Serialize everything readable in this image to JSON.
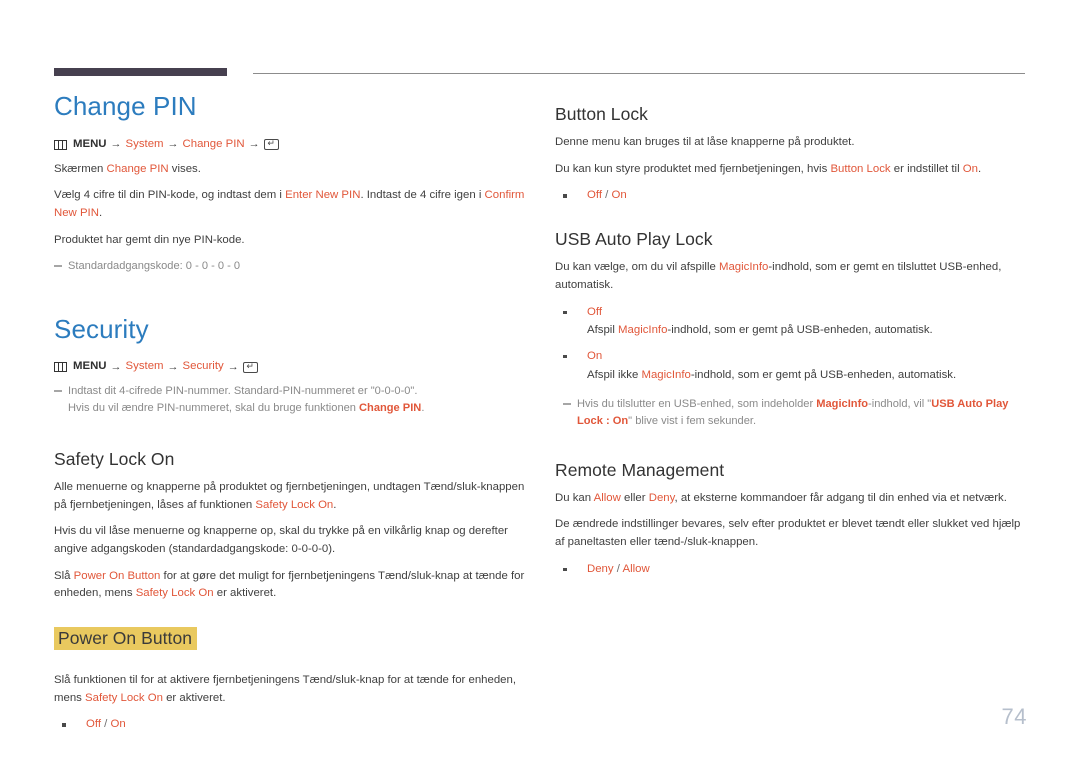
{
  "page": {
    "number": "74",
    "accent_color": "#e1573a",
    "heading_color": "#2c7cbe",
    "highlight_color": "#e9c95f",
    "rule_color": "#46404f"
  },
  "left_column": {
    "change_pin": {
      "title": "Change PIN",
      "menu_path": {
        "icon": "menu-icon",
        "root": "MENU",
        "arrow": "→",
        "step1": "System",
        "step2": "Change PIN",
        "enter_icon": "enter-key-icon",
        "enter_glyph": "↵"
      },
      "p1_a": "Skærmen ",
      "p1_accent": "Change PIN",
      "p1_b": " vises.",
      "p2_a": "Vælg 4 cifre til din PIN-kode, og indtast dem i ",
      "p2_accent1": "Enter New PIN",
      "p2_b": ". Indtast de 4 cifre igen i ",
      "p2_accent2": "Confirm New PIN",
      "p2_c": ".",
      "p3": "Produktet har gemt din nye PIN-kode.",
      "note1": "Standardadgangskode: 0 - 0 - 0 - 0"
    },
    "security": {
      "title": "Security",
      "menu_path": {
        "icon": "menu-icon",
        "root": "MENU",
        "arrow": "→",
        "step1": "System",
        "step2": "Security",
        "enter_icon": "enter-key-icon",
        "enter_glyph": "↵"
      },
      "note_line1": "Indtast dit 4-cifrede PIN-nummer. Standard-PIN-nummeret er \"0-0-0-0\".",
      "note_line2_a": "Hvis du vil ændre PIN-nummeret, skal du bruge funktionen ",
      "note_line2_accent": "Change PIN",
      "note_line2_b": "."
    },
    "safety_lock_on": {
      "title": "Safety Lock On",
      "p1_a": "Alle menuerne og knapperne på produktet og fjernbetjeningen, undtagen Tænd/sluk-knappen på fjernbetjeningen, låses af funktionen ",
      "p1_accent": "Safety Lock On",
      "p1_b": ".",
      "p2": "Hvis du vil låse menuerne og knapperne op, skal du trykke på en vilkårlig knap og derefter angive adgangskoden (standardadgangskode: 0-0-0-0).",
      "p3_a": "Slå ",
      "p3_accent1": "Power On Button",
      "p3_b": " for at gøre det muligt for fjernbetjeningens Tænd/sluk-knap at tænde for enheden, mens ",
      "p3_accent2": "Safety Lock On",
      "p3_c": " er aktiveret."
    },
    "power_on_button": {
      "title": "Power On Button",
      "p1_a": "Slå funktionen til for at aktivere fjernbetjeningens Tænd/sluk-knap for at tænde for enheden, mens ",
      "p1_accent": "Safety Lock On",
      "p1_b": " er aktiveret.",
      "options": {
        "off": "Off",
        "slash": " / ",
        "on": "On"
      }
    }
  },
  "right_column": {
    "button_lock": {
      "title": "Button Lock",
      "p1": "Denne menu kan bruges til at låse knapperne på produktet.",
      "p2_a": "Du kan kun styre produktet med fjernbetjeningen, hvis ",
      "p2_accent1": "Button Lock",
      "p2_b": " er indstillet til ",
      "p2_accent2": "On",
      "p2_c": ".",
      "options": {
        "off": "Off",
        "slash": " / ",
        "on": "On"
      }
    },
    "usb_auto_play_lock": {
      "title": "USB Auto Play Lock",
      "p1_a": "Du kan vælge, om du vil afspille ",
      "p1_accent": "MagicInfo",
      "p1_b": "-indhold, som er gemt en tilsluttet USB-enhed, automatisk.",
      "bullet_off": {
        "label": "Off",
        "desc_a": "Afspil ",
        "desc_accent": "MagicInfo",
        "desc_b": "-indhold, som er gemt på USB-enheden, automatisk."
      },
      "bullet_on": {
        "label": "On",
        "desc_a": "Afspil ikke ",
        "desc_accent": "MagicInfo",
        "desc_b": "-indhold, som er gemt på USB-enheden, automatisk."
      },
      "note_a": "Hvis du tilslutter en USB-enhed, som indeholder ",
      "note_accent1": "MagicInfo",
      "note_b": "-indhold, vil \"",
      "note_accent2": "USB Auto Play Lock : On",
      "note_c": "\" blive vist i fem sekunder."
    },
    "remote_management": {
      "title": "Remote Management",
      "p1_a": "Du kan ",
      "p1_accent1": "Allow",
      "p1_b": " eller ",
      "p1_accent2": "Deny",
      "p1_c": ", at eksterne kommandoer får adgang til din enhed via et netværk.",
      "p2": "De ændrede indstillinger bevares, selv efter produktet er blevet tændt eller slukket ved hjælp af paneltasten eller tænd-/sluk-knappen.",
      "options": {
        "deny": "Deny",
        "slash": " / ",
        "allow": "Allow"
      }
    }
  }
}
